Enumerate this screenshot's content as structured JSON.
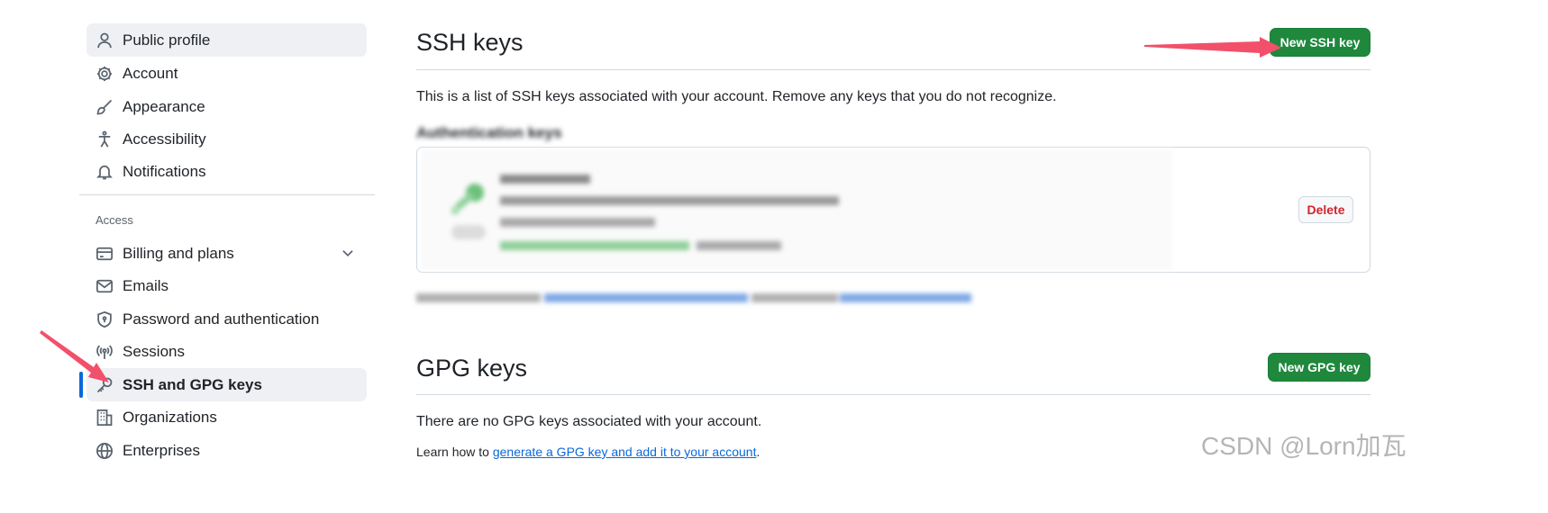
{
  "sidebar": {
    "items_top": [
      {
        "label": "Public profile",
        "icon": "person-icon"
      },
      {
        "label": "Account",
        "icon": "gear-icon"
      },
      {
        "label": "Appearance",
        "icon": "paintbrush-icon"
      },
      {
        "label": "Accessibility",
        "icon": "accessibility-icon"
      },
      {
        "label": "Notifications",
        "icon": "bell-icon"
      }
    ],
    "section_label": "Access",
    "items_access": [
      {
        "label": "Billing and plans",
        "icon": "credit-card-icon"
      },
      {
        "label": "Emails",
        "icon": "mail-icon"
      },
      {
        "label": "Password and authentication",
        "icon": "shield-lock-icon"
      },
      {
        "label": "Sessions",
        "icon": "broadcast-icon"
      },
      {
        "label": "SSH and GPG keys",
        "icon": "key-icon"
      },
      {
        "label": "Organizations",
        "icon": "organization-icon"
      },
      {
        "label": "Enterprises",
        "icon": "globe-icon"
      }
    ]
  },
  "ssh": {
    "title": "SSH keys",
    "new_button": "New SSH key",
    "description": "This is a list of SSH keys associated with your account. Remove any keys that you do not recognize.",
    "auth_heading": "Authentication keys",
    "delete_button": "Delete"
  },
  "gpg": {
    "title": "GPG keys",
    "new_button": "New GPG key",
    "empty_text": "There are no GPG keys associated with your account.",
    "learn_prefix": "Learn how to ",
    "learn_link": "generate a GPG key and add it to your account",
    "learn_suffix": "."
  },
  "watermark": "CSDN @Lorn加瓦",
  "colors": {
    "accent_blue": "#0969da",
    "button_green": "#1f883d",
    "danger_red": "#d1242f",
    "annotation_arrow": "#f2506a"
  }
}
